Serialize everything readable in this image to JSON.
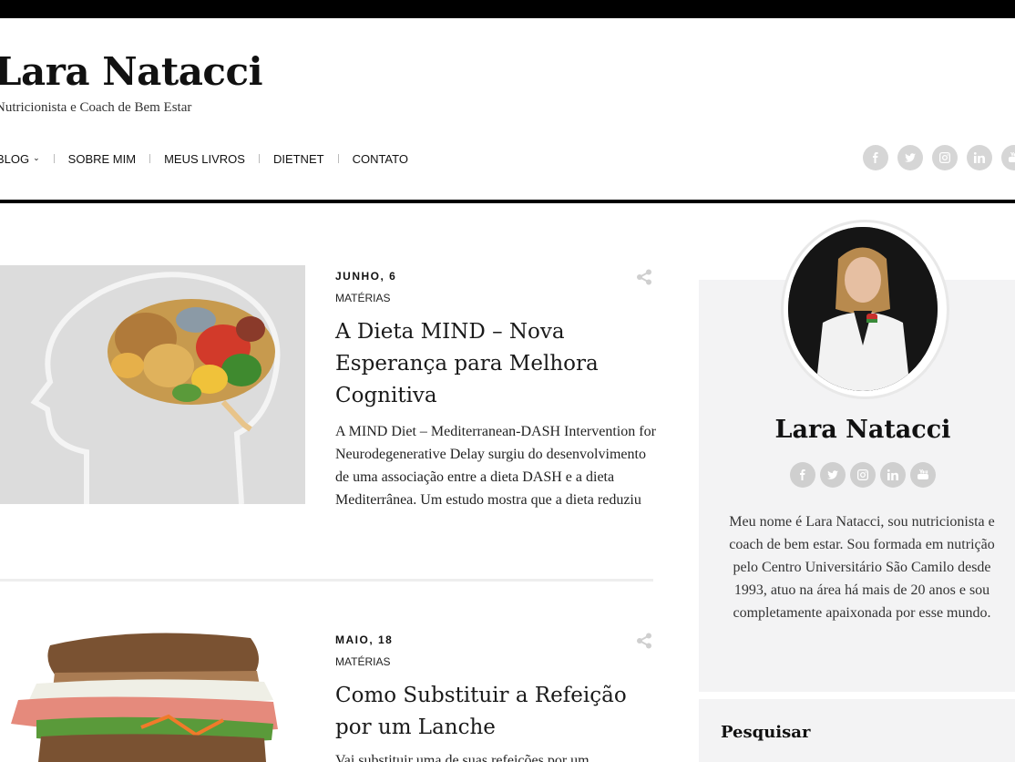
{
  "site": {
    "title": "Lara Natacci",
    "tagline": "Nutricionista e Coach de Bem Estar"
  },
  "nav": {
    "items": [
      {
        "label": "BLOG",
        "has_dropdown": true
      },
      {
        "label": "SOBRE MIM",
        "has_dropdown": false
      },
      {
        "label": "MEUS LIVROS",
        "has_dropdown": false
      },
      {
        "label": "DIETNET",
        "has_dropdown": false
      },
      {
        "label": "CONTATO",
        "has_dropdown": false
      }
    ]
  },
  "social": {
    "icons": [
      "facebook-icon",
      "twitter-icon",
      "instagram-icon",
      "linkedin-icon",
      "youtube-icon"
    ],
    "glyphs": [
      "f",
      "t",
      "ig",
      "in",
      "yt"
    ]
  },
  "posts": [
    {
      "date": "JUNHO, 6",
      "category": "MATÉRIAS",
      "title": "A Dieta MIND – Nova Esperança para Melhora Cognitiva",
      "excerpt": "A MIND Diet  – Mediterranean-DASH Intervention for Neurodegenerative Delay surgiu do desenvolvimento de uma associação entre a dieta DASH e a dieta Mediterrânea.  Um estudo mostra que a dieta reduziu"
    },
    {
      "date": "MAIO, 18",
      "category": "MATÉRIAS",
      "title": "Como Substituir a Refeição por um Lanche",
      "excerpt": "Vai substituir uma de suas refeições por um"
    }
  ],
  "sidebar": {
    "about_name": "Lara Natacci",
    "about_text": "Meu nome é Lara Natacci, sou nutricionista e coach de bem estar. Sou formada em nutrição pelo Centro Universitário São Camilo desde 1993, atuo na área há mais de 20 anos e sou completamente apaixonada por esse mundo.",
    "search_title": "Pesquisar"
  },
  "colors": {
    "topbar": "#000000",
    "social_bg": "#d6d6d6",
    "sidebar_bg": "#f3f3f4"
  }
}
